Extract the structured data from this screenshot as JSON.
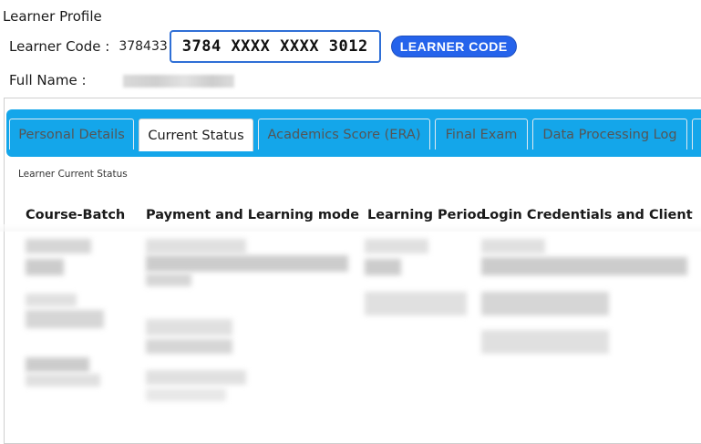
{
  "page": {
    "title": "Learner Profile"
  },
  "learner": {
    "code_label": "Learner Code :",
    "code_prefix": "378433",
    "code_masked": "3784 XXXX XXXX 3012",
    "code_badge": "LEARNER CODE",
    "name_label": "Full Name :"
  },
  "tabs": [
    {
      "label": "Personal Details",
      "active": false
    },
    {
      "label": "Current Status",
      "active": true
    },
    {
      "label": "Academics Score (ERA)",
      "active": false
    },
    {
      "label": "Final Exam",
      "active": false
    },
    {
      "label": "Data Processing Log",
      "active": false
    }
  ],
  "status_panel": {
    "subtitle": "Learner Current Status",
    "columns": [
      "Course-Batch",
      "Payment and Learning mode",
      "Learning Period",
      "Login Credentials and Client"
    ]
  },
  "colors": {
    "tab_bar": "#14a6ea",
    "code_border": "#2f6fd6",
    "badge_bg": "#2563eb"
  }
}
